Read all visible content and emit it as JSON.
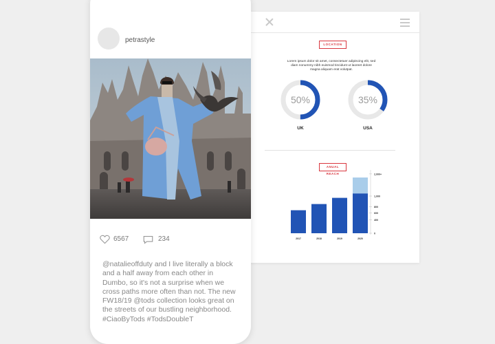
{
  "post": {
    "username": "petrastyle",
    "likes": "6567",
    "comments": "234",
    "caption": "@natalieoffduty and I live literally a block and a half away from each other in Dumbo, so it's not a surprise when we cross paths more often than not. The new FW18/19 @tods collection looks great on the streets of our bustling neighborhood. #CiaoByTods #TodsDoubleT"
  },
  "analytics": {
    "location_tag": "LOCATION",
    "lorem": "Lorem ipsum dolor sit amet, consectetuer adipiscing elit, sed diam nonummy nibh euismod tincidunt ut laoreet dolore magna aliquam erat volutpat.",
    "locations": [
      {
        "country": "UK",
        "percent": 50,
        "label": "50%"
      },
      {
        "country": "USA",
        "percent": 35,
        "label": "35%"
      }
    ],
    "reach_tag": "ANUAL REACH",
    "colors": {
      "primary": "#2154b5",
      "light": "#a9cdea",
      "track": "#e8e8e8",
      "tag": "#d9363e"
    }
  },
  "chart_data": {
    "type": "bar",
    "categories": [
      "2017",
      "2018",
      "2019",
      "2020"
    ],
    "series": [
      {
        "values": [
          130,
          165,
          200,
          225
        ]
      },
      {
        "values": [
          0,
          0,
          0,
          90
        ]
      }
    ],
    "ylim": [
      0,
      350
    ],
    "yticks": [
      {
        "value": 0,
        "label": "0"
      },
      {
        "value": 75,
        "label": "400"
      },
      {
        "value": 115,
        "label": "600"
      },
      {
        "value": 150,
        "label": "800"
      },
      {
        "value": 210,
        "label": "1,000"
      },
      {
        "value": 335,
        "label": "2,000+"
      }
    ],
    "grid": false
  }
}
